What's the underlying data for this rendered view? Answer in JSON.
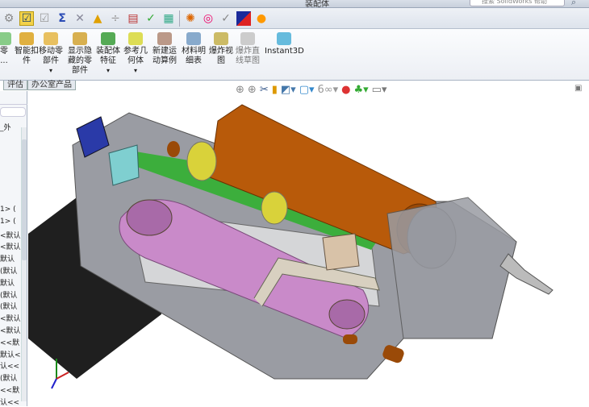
{
  "window": {
    "title": "装配体",
    "search_placeholder": "搜索 SolidWorks 帮助"
  },
  "ribbon": {
    "buttons": [
      {
        "label": "零\n..."
      },
      {
        "label": "智能扣\n件"
      },
      {
        "label": "移动零\n部件"
      },
      {
        "label": "显示隐\n藏的零\n部件"
      },
      {
        "label": "装配体\n特征"
      },
      {
        "label": "参考几\n何体"
      },
      {
        "label": "新建运\n动算例"
      },
      {
        "label": "材料明\n细表"
      },
      {
        "label": "爆炸视\n图"
      },
      {
        "label": "爆炸直\n线草图"
      },
      {
        "label": "Instant3D"
      }
    ]
  },
  "tabs": [
    "评估",
    "办公室产品"
  ],
  "tree": {
    "header": "_外",
    "items": [
      "1> (",
      "1> (",
      "<默认",
      "<默认",
      "默认",
      "(默认",
      "默认",
      "(默认",
      "(默认",
      "<默认",
      "<默认",
      "<<默",
      "默认<",
      "认<<",
      "(默认",
      "<<默",
      "认<<"
    ]
  },
  "colors": {
    "chassis": "#9a9ca3",
    "cylinder": "#b85a0a",
    "belt": "#c98ac9",
    "motor": "#1f1f1f",
    "bracket": "#2a3aa8",
    "green": "#3cae3c"
  }
}
